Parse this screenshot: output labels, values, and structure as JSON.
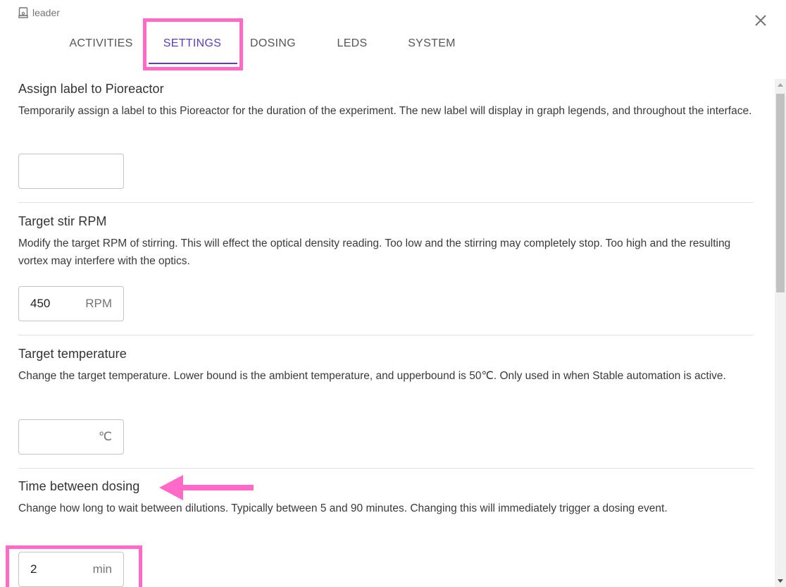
{
  "header": {
    "label": "leader",
    "icon": "pioreactor-icon"
  },
  "close_icon": "close-icon",
  "tabs": [
    {
      "label": "ACTIVITIES"
    },
    {
      "label": "SETTINGS",
      "active": true
    },
    {
      "label": "DOSING"
    },
    {
      "label": "LEDS"
    },
    {
      "label": "SYSTEM"
    }
  ],
  "sections": {
    "label": {
      "title": "Assign label to Pioreactor",
      "description": "Temporarily assign a label to this Pioreactor for the duration of the experiment. The new label will display in graph legends, and throughout the interface.",
      "value": ""
    },
    "stir": {
      "title": "Target stir RPM",
      "description": "Modify the target RPM of stirring. This will effect the optical density reading. Too low and the stirring may completely stop. Too high and the resulting vortex may interfere with the optics.",
      "value": "450",
      "unit": "RPM"
    },
    "temperature": {
      "title": "Target temperature",
      "description": "Change the target temperature. Lower bound is the ambient temperature, and upperbound is 50℃. Only used in when Stable automation is active.",
      "value": "",
      "unit": "℃"
    },
    "dosing": {
      "title": "Time between dosing",
      "description": "Change how long to wait between dilutions. Typically between 5 and 90 minutes. Changing this will immediately trigger a dosing event.",
      "value": "2",
      "unit": "min"
    }
  },
  "colors": {
    "accent": "#5b3cc4",
    "annotation": "#ff69c8",
    "divider": "#e0e0e0"
  }
}
